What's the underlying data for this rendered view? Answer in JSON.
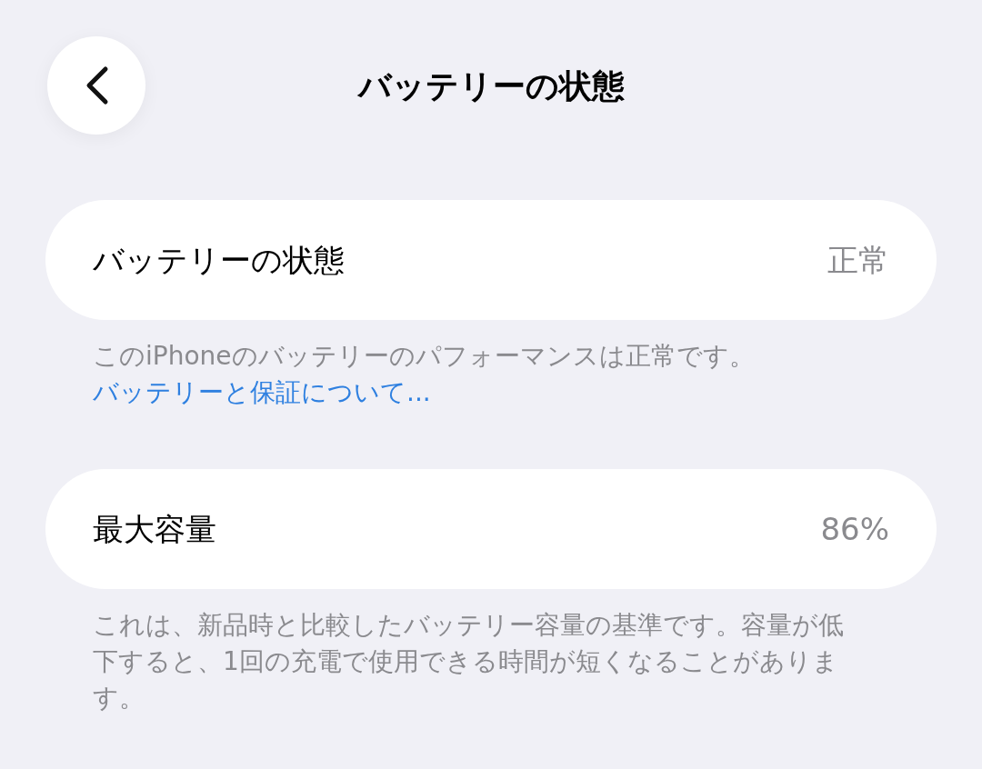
{
  "nav": {
    "title": "バッテリーの状態"
  },
  "sections": [
    {
      "label": "バッテリーの状態",
      "value": "正常",
      "footnote": {
        "text": "このiPhoneのバッテリーのパフォーマンスは正常です。",
        "link": "バッテリーと保証について..."
      }
    },
    {
      "label": "最大容量",
      "value": "86%",
      "footnote": {
        "text": "これは、新品時と比較したバッテリー容量の基準です。容量が低下すると、1回の充電で使用できる時間が短くなることがあります。"
      }
    }
  ]
}
